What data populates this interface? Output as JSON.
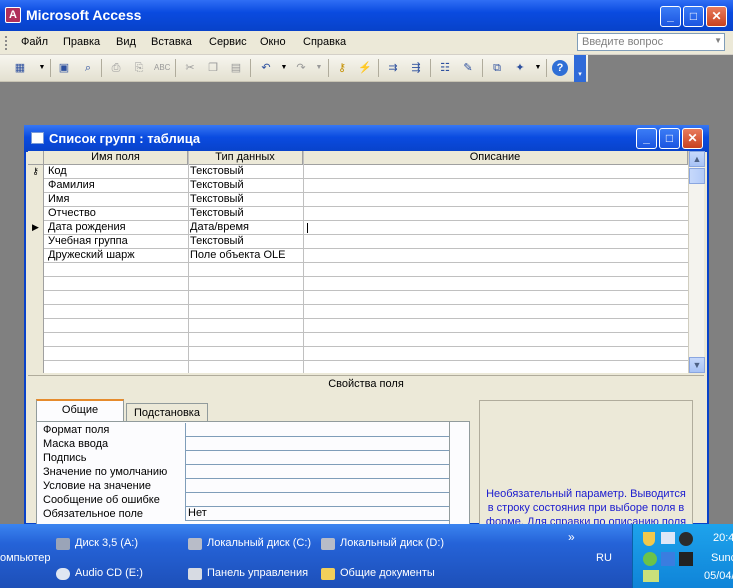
{
  "app": {
    "title": "Microsoft Access",
    "min_label": "_",
    "max_label": "□",
    "close_label": "✕"
  },
  "menu": {
    "items": [
      "Файл",
      "Правка",
      "Вид",
      "Вставка",
      "Сервис",
      "Окно",
      "Справка"
    ],
    "ask_placeholder": "Введите вопрос"
  },
  "toolbar": {
    "icons": [
      "view-icon",
      "save-icon",
      "search-file-icon",
      "print-icon",
      "print-preview-icon",
      "spelling-icon",
      "cut-icon",
      "copy-icon",
      "paste-icon",
      "undo-icon",
      "redo-icon",
      "primary-key-icon",
      "indexes-icon",
      "insert-rows-icon",
      "delete-rows-icon",
      "properties-icon",
      "build-icon",
      "database-window-icon",
      "new-object-icon",
      "help-icon"
    ]
  },
  "table_window": {
    "title": "Список групп : таблица",
    "headers": {
      "field": "Имя поля",
      "type": "Тип данных",
      "desc": "Описание"
    },
    "rows": [
      {
        "field": "Код",
        "type": "Текстовый",
        "marker": "key"
      },
      {
        "field": "Фамилия",
        "type": "Текстовый",
        "marker": ""
      },
      {
        "field": "Имя",
        "type": "Текстовый",
        "marker": ""
      },
      {
        "field": "Отчество",
        "type": "Текстовый",
        "marker": ""
      },
      {
        "field": "Дата рождения",
        "type": "Дата/время",
        "marker": "current"
      },
      {
        "field": "Учебная группа",
        "type": "Текстовый",
        "marker": ""
      },
      {
        "field": "Дружеский шарж",
        "type": "Поле объекта OLE",
        "marker": ""
      }
    ],
    "props_title": "Свойства поля",
    "tabs": [
      "Общие",
      "Подстановка"
    ],
    "properties": [
      {
        "label": "Формат поля",
        "value": ""
      },
      {
        "label": "Маска ввода",
        "value": ""
      },
      {
        "label": "Подпись",
        "value": ""
      },
      {
        "label": "Значение по умолчанию",
        "value": ""
      },
      {
        "label": "Условие на значение",
        "value": ""
      },
      {
        "label": "Сообщение об ошибке",
        "value": ""
      },
      {
        "label": "Обязательное поле",
        "value": "Нет"
      }
    ],
    "hint": "Необязательный параметр.  Выводится в строку состояния при выборе поля в форме.  Для справки по описанию поля"
  },
  "taskbar": {
    "left_cut": "омпьютер",
    "items": [
      {
        "label": "Диск 3,5 (A:)",
        "icon": "floppy-icon"
      },
      {
        "label": "Локальный диск (C:)",
        "icon": "disk-icon"
      },
      {
        "label": "Локальный диск (D:)",
        "icon": "disk-icon"
      },
      {
        "label": "Audio CD (E:)",
        "icon": "cd-icon"
      },
      {
        "label": "Панель управления",
        "icon": "control-panel-icon"
      },
      {
        "label": "Общие документы",
        "icon": "folder-icon"
      }
    ],
    "chevron": "»",
    "lang": "RU",
    "time": "20:4",
    "day": "Sunc",
    "date": "05/04/"
  }
}
